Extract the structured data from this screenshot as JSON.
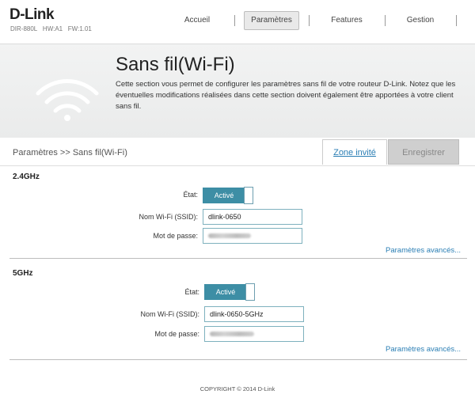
{
  "header": {
    "logo": "D-Link",
    "device_model": "DIR-880L",
    "hw": "HW:A1",
    "fw": "FW:1.01",
    "nav": [
      {
        "label": "Accueil",
        "active": false
      },
      {
        "label": "Paramètres",
        "active": true
      },
      {
        "label": "Features",
        "active": false
      },
      {
        "label": "Gestion",
        "active": false
      }
    ]
  },
  "banner": {
    "title": "Sans fil(Wi-Fi)",
    "description": "Cette section vous permet de configurer les paramètres sans fil de votre routeur D-Link. Notez que les éventuelles modifications réalisées dans cette section doivent également être apportées à votre client sans fil.",
    "icon": "wifi-icon"
  },
  "breadcrumb": "Paramètres >> Sans fil(Wi-Fi)",
  "actions": {
    "guest_zone": "Zone invité",
    "save": "Enregistrer"
  },
  "band_24": {
    "title": "2.4GHz",
    "state_label": "État:",
    "state_value": "Activé",
    "ssid_label": "Nom Wi-Fi (SSID):",
    "ssid_value": "dlink-0650",
    "password_label": "Mot de passe:",
    "advanced_link": "Paramètres avancés..."
  },
  "band_5": {
    "title": "5GHz",
    "state_label": "État:",
    "state_value": "Activé",
    "ssid_label": "Nom Wi-Fi (SSID):",
    "ssid_value": "dlink-0650-5GHz",
    "password_label": "Mot de passe:",
    "advanced_link": "Paramètres avancés..."
  },
  "footer": "COPYRIGHT © 2014 D-Link",
  "colors": {
    "accent": "#3d8ea5",
    "link": "#2a7eb4"
  }
}
